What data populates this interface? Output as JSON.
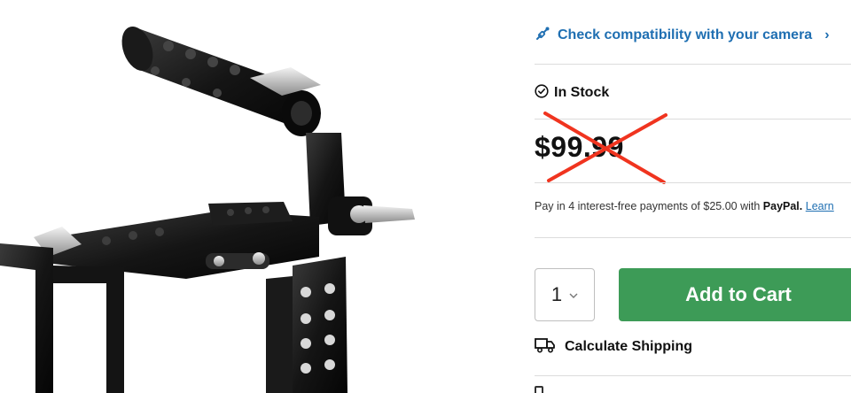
{
  "product": {
    "image_alt": "Camera cage with top handle"
  },
  "compatibility": {
    "label": "Check compatibility with your camera",
    "icon": "link-icon",
    "chevron": "›"
  },
  "stock": {
    "label": "In Stock",
    "icon": "check-circle-icon"
  },
  "price": {
    "value": "$99.99",
    "strike_color": "#f0341f"
  },
  "paypal": {
    "prefix": "Pay in 4 interest-free payments of $25.00 with ",
    "brand": "PayPal.",
    "link": "Learn"
  },
  "quantity": {
    "value": "1"
  },
  "cart": {
    "button_label": "Add to Cart",
    "color": "#3d9b57"
  },
  "shipping": {
    "label": "Calculate Shipping",
    "icon": "truck-icon"
  },
  "colors": {
    "link": "#1f6fb2",
    "divider": "#dcdcdc"
  }
}
